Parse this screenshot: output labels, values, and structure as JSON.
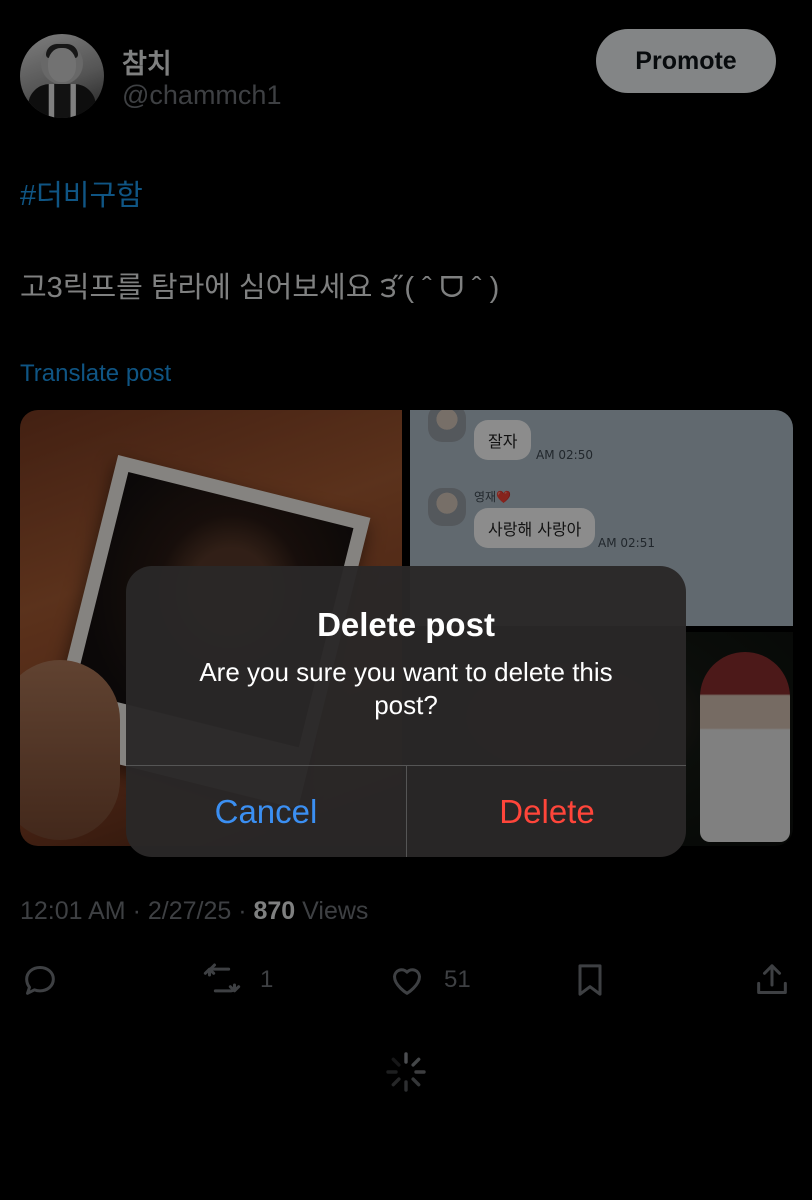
{
  "profile": {
    "display_name": "참치",
    "handle": "@chammch1"
  },
  "promote_label": "Promote",
  "post": {
    "hashtag": "#더비구함",
    "text": "고3릭프를 탐라에 심어보세요 ౩̋ ( ˆ ᗜ ˆ )",
    "translate_label": "Translate post"
  },
  "media": {
    "chat": [
      {
        "message": "잘자",
        "time": "AM 02:50"
      },
      {
        "name": "영재❤️",
        "message": "사랑해 사랑아",
        "time": "AM 02:51"
      }
    ]
  },
  "meta": {
    "time": "12:01 AM",
    "date": "2/27/25",
    "views_count": "870",
    "views_label": "Views"
  },
  "actions": {
    "reply_icon": "reply-icon",
    "repost_icon": "repost-icon",
    "repost_count": "1",
    "like_icon": "heart-icon",
    "like_count": "51",
    "bookmark_icon": "bookmark-icon",
    "share_icon": "share-icon"
  },
  "dialog": {
    "title": "Delete post",
    "message": "Are you sure you want to delete this post?",
    "cancel_label": "Cancel",
    "delete_label": "Delete"
  },
  "colors": {
    "background": "#000000",
    "accent": "#1d9bf0",
    "cancel": "#3b8ff2",
    "destructive": "#ff453a"
  }
}
